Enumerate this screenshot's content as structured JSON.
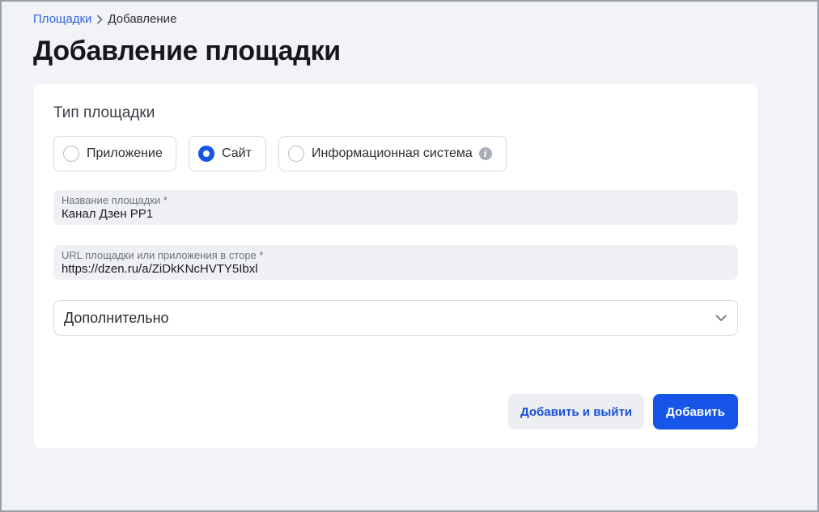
{
  "breadcrumb": {
    "parent": "Площадки",
    "current": "Добавление"
  },
  "page": {
    "title": "Добавление площадки"
  },
  "platform_type": {
    "title": "Тип площадки",
    "options": [
      {
        "label": "Приложение",
        "checked": false
      },
      {
        "label": "Сайт",
        "checked": true
      },
      {
        "label": "Информационная система",
        "checked": false,
        "icon": "info-icon"
      }
    ]
  },
  "fields": {
    "name": {
      "label": "Название площадки *",
      "value": "Канал Дзен РР1"
    },
    "url": {
      "label": "URL площадки или приложения в сторе *",
      "value": "https://dzen.ru/a/ZiDkKNcHVTY5Ibxl"
    }
  },
  "additional": {
    "label": "Дополнительно"
  },
  "actions": {
    "add_and_exit": "Добавить и выйти",
    "add": "Добавить"
  },
  "colors": {
    "accent": "#1755e8",
    "link": "#2f63e0",
    "background": "#f2f3f6",
    "field_bg": "#eef0f3"
  }
}
